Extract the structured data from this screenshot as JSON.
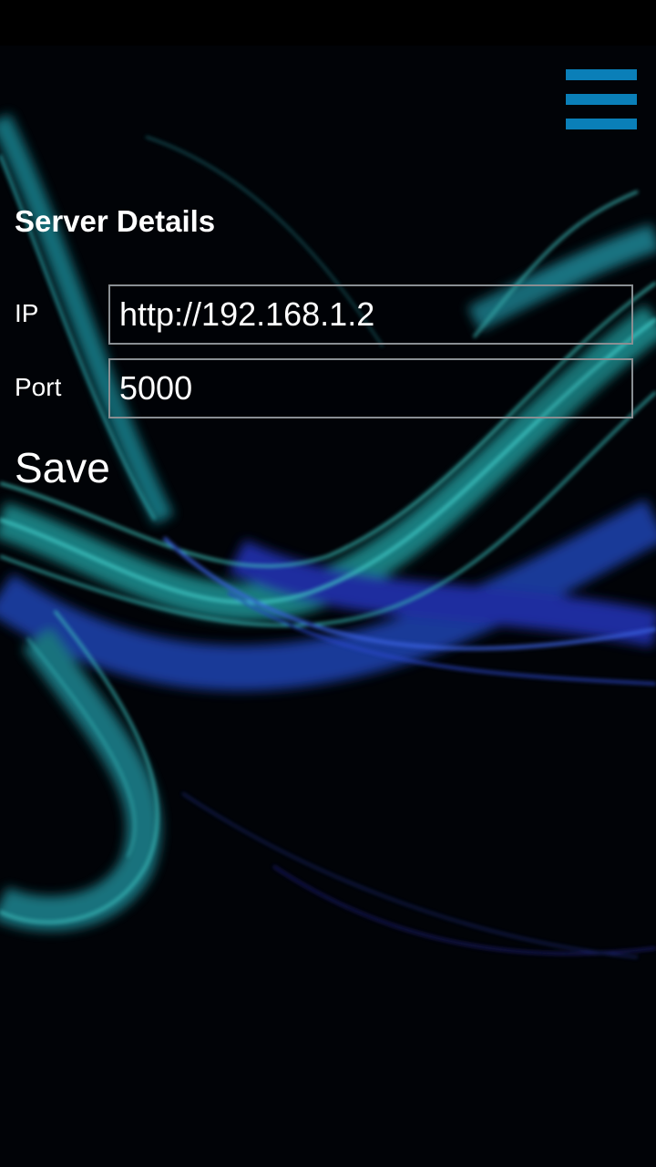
{
  "header": {
    "menu_icon": "hamburger-menu-icon",
    "accent_color": "#0a7fb8"
  },
  "form": {
    "title": "Server Details",
    "ip": {
      "label": "IP",
      "value": "http://192.168.1.2"
    },
    "port": {
      "label": "Port",
      "value": "5000"
    },
    "save_label": "Save"
  },
  "theme": {
    "background": "#000000",
    "text_color": "#ffffff",
    "input_border": "#8a8f93"
  }
}
